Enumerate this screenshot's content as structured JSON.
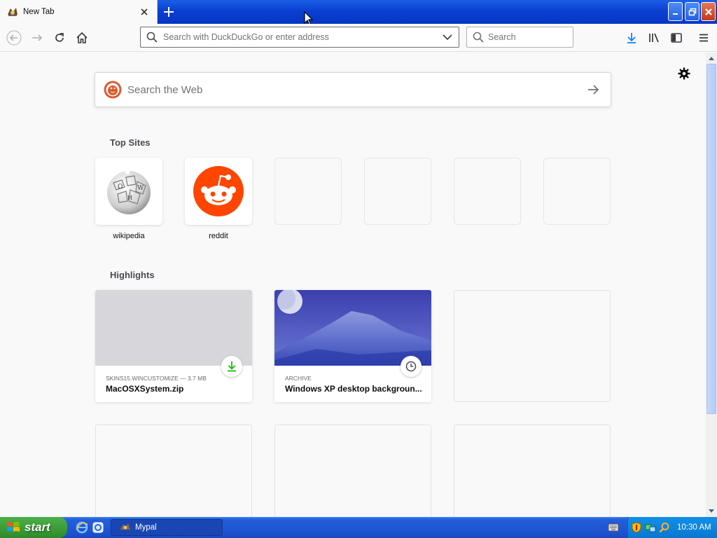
{
  "tab": {
    "title": "New Tab"
  },
  "window": {
    "buttons": [
      "minimize",
      "restore",
      "close"
    ]
  },
  "toolbar": {
    "urlbar_placeholder": "Search with DuckDuckGo or enter address",
    "search_placeholder": "Search"
  },
  "page": {
    "websearch_placeholder": "Search the Web",
    "topsites_title": "Top Sites",
    "highlights_title": "Highlights",
    "topsites": [
      {
        "label": "wikipedia",
        "icon": "wikipedia-globe-icon"
      },
      {
        "label": "reddit",
        "icon": "reddit-alien-icon"
      }
    ],
    "highlights": [
      {
        "context": "SKINS15.WINCUSTOMIZE — 3.7 MB",
        "title": "MacOSXSystem.zip",
        "badge": "download-icon"
      },
      {
        "context": "ARCHIVE",
        "title": "Windows XP desktop backgroun...",
        "badge": "clock-icon"
      }
    ]
  },
  "taskbar": {
    "start_label": "start",
    "task_item_label": "Mypal",
    "clock": "10:30 AM"
  },
  "colors": {
    "xp_blue": "#245edb",
    "start_green": "#3a9a35",
    "reddit_orange": "#ff4500",
    "download_green": "#12bc00"
  }
}
